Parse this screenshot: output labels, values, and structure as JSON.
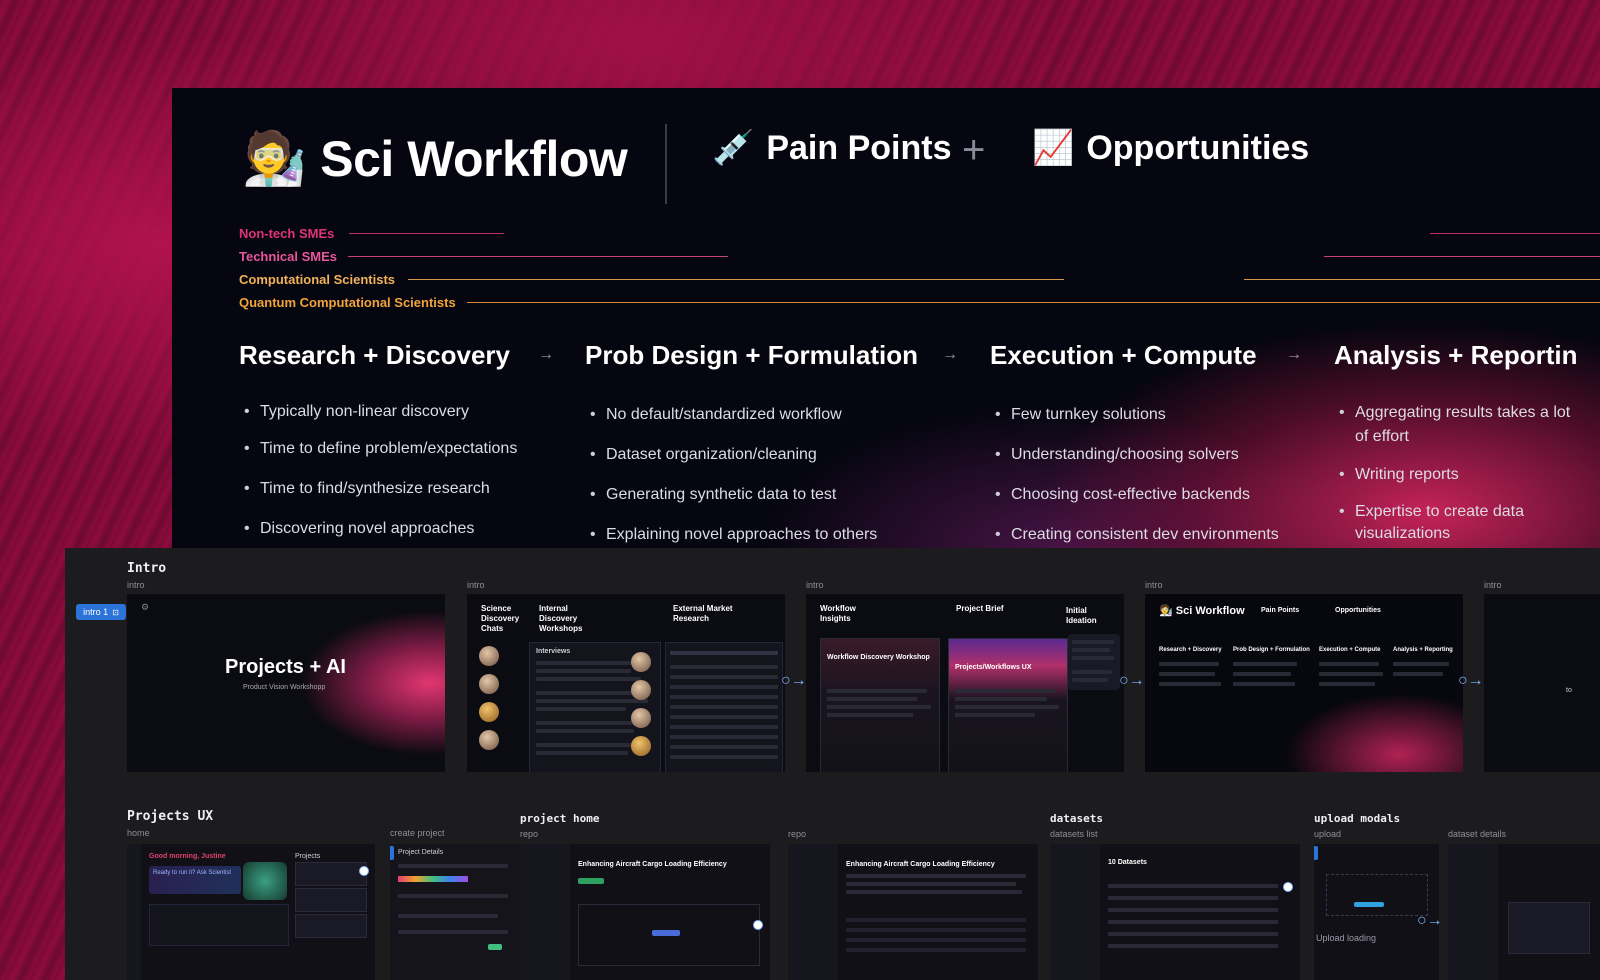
{
  "slide": {
    "title": "Sci Workflow",
    "title_emoji": "🧑‍🔬",
    "pain_points": "Pain Points",
    "pain_icon": "💉",
    "plus": "+",
    "opportunities": "Opportunities",
    "opps_icon": "📈",
    "personas": [
      {
        "label": "Non-tech SMEs",
        "color": "#e0347a"
      },
      {
        "label": "Technical SMEs",
        "color": "#e8569a"
      },
      {
        "label": "Computational Scientists",
        "color": "#f0b35a"
      },
      {
        "label": "Quantum Computational Scientists",
        "color": "#f2a33a"
      }
    ],
    "stages": [
      {
        "title": "Research + Discovery",
        "bullets": [
          "Typically non-linear discovery",
          "Time to define problem/expectations",
          "Time to find/synthesize research",
          "Discovering novel approaches"
        ]
      },
      {
        "title": "Prob Design + Formulation",
        "bullets": [
          "No default/standardized workflow",
          "Dataset organization/cleaning",
          "Generating synthetic data to test",
          "Explaining novel approaches to others"
        ]
      },
      {
        "title": "Execution + Compute",
        "bullets": [
          "Few turnkey solutions",
          "Understanding/choosing solvers",
          "Choosing cost-effective backends",
          "Creating consistent dev environments"
        ]
      },
      {
        "title": "Analysis + Reportin",
        "bullets": [
          "Aggregating results takes a lot of effort",
          "Writing reports",
          "Expertise to create data visualizations"
        ]
      }
    ]
  },
  "canvas": {
    "intro": {
      "title": "Intro",
      "tag": "intro 1",
      "frame_label": "intro",
      "frames": [
        {
          "heading": "Projects + AI",
          "sub": "Product Vision Workshopp"
        },
        {
          "cols": [
            "Science Discovery Chats",
            "Internal Discovery Workshops",
            "External Market Research"
          ],
          "sub": "Interviews"
        },
        {
          "cols": [
            "Workflow Insights",
            "Project Brief",
            "Initial Ideation"
          ],
          "card1": "Workflow Discovery Workshop",
          "card2": "Projects/Workflows UX"
        },
        {
          "title": "Sci Workflow",
          "pain": "Pain Points",
          "opps": "Opportunities",
          "stages": [
            "Research + Discovery",
            "Prob Design + Formulation",
            "Execution + Compute",
            "Analysis + Reporting"
          ]
        }
      ],
      "edge_label": "to"
    },
    "projects": {
      "title": "Projects UX",
      "home_label": "home",
      "create_label": "create project",
      "greeting": "Good morning, Justine",
      "card": "Ready to run it? Ask Scientist",
      "project_list_title": "Projects",
      "project_details": "Project Details"
    },
    "project_home": {
      "title": "project home",
      "label1": "repo",
      "label2": "repo",
      "heading": "Enhancing Aircraft Cargo Loading Efficiency"
    },
    "datasets": {
      "title": "datasets",
      "label": "datasets list",
      "count": "10 Datasets"
    },
    "upload": {
      "title": "upload modals",
      "label": "upload",
      "details_label": "dataset details",
      "loading": "Upload loading"
    }
  }
}
